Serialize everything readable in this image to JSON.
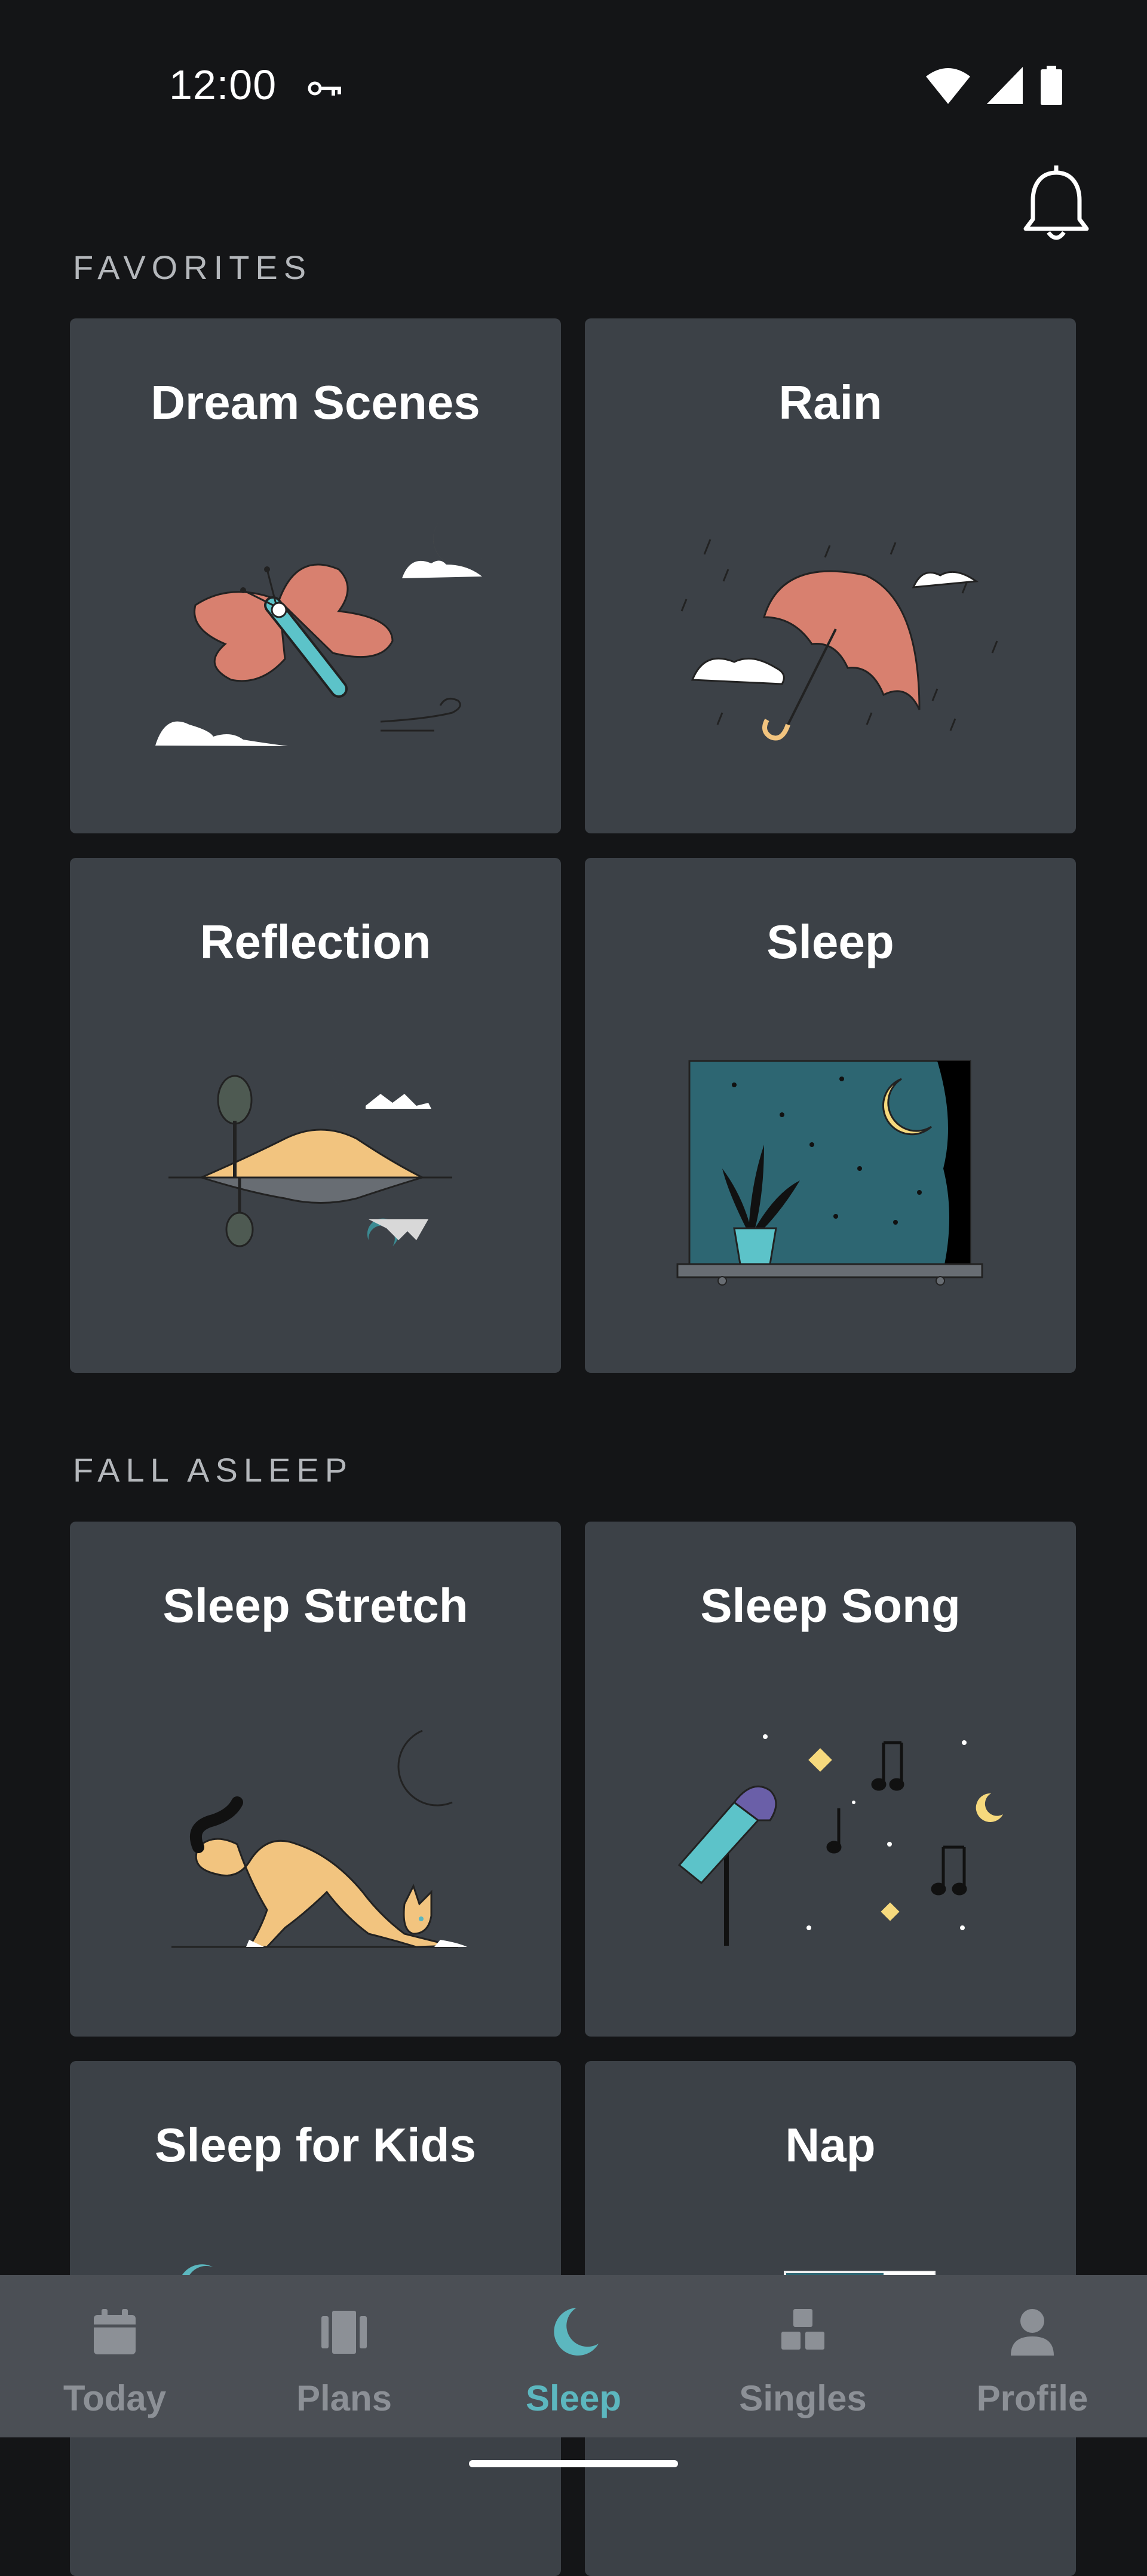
{
  "status_bar": {
    "time": "12:00",
    "icons": [
      "vpn-key-icon",
      "wifi-icon",
      "cellular-signal-icon",
      "battery-icon"
    ]
  },
  "header": {
    "notification_icon": "bell-icon"
  },
  "sections": {
    "favorites": {
      "title": "FAVORITES",
      "cards": [
        {
          "title": "Dream Scenes",
          "art": "butterfly-clouds-moon"
        },
        {
          "title": "Rain",
          "art": "umbrella-rain-clouds"
        },
        {
          "title": "Reflection",
          "art": "island-reflection"
        },
        {
          "title": "Sleep",
          "art": "night-window-plant"
        }
      ]
    },
    "fall_asleep": {
      "title": "FALL ASLEEP",
      "cards": [
        {
          "title": "Sleep Stretch",
          "art": "cat-stretching-moon"
        },
        {
          "title": "Sleep Song",
          "art": "microphone-music-notes"
        },
        {
          "title": "Sleep for Kids",
          "art": "moon"
        },
        {
          "title": "Nap",
          "art": "window"
        }
      ]
    }
  },
  "bottom_nav": {
    "items": [
      {
        "label": "Today",
        "icon": "calendar-icon"
      },
      {
        "label": "Plans",
        "icon": "plans-icon"
      },
      {
        "label": "Sleep",
        "icon": "moon-icon",
        "active": true
      },
      {
        "label": "Singles",
        "icon": "singles-icon"
      },
      {
        "label": "Profile",
        "icon": "person-icon"
      }
    ]
  },
  "colors": {
    "background": "#141517",
    "card": "#3c4147",
    "nav_bar": "#4b4f55",
    "accent": "#5cb7bf",
    "inactive": "#8c9096",
    "coral": "#d8806f",
    "sand": "#f2c47f",
    "yellow": "#f6d97d"
  }
}
